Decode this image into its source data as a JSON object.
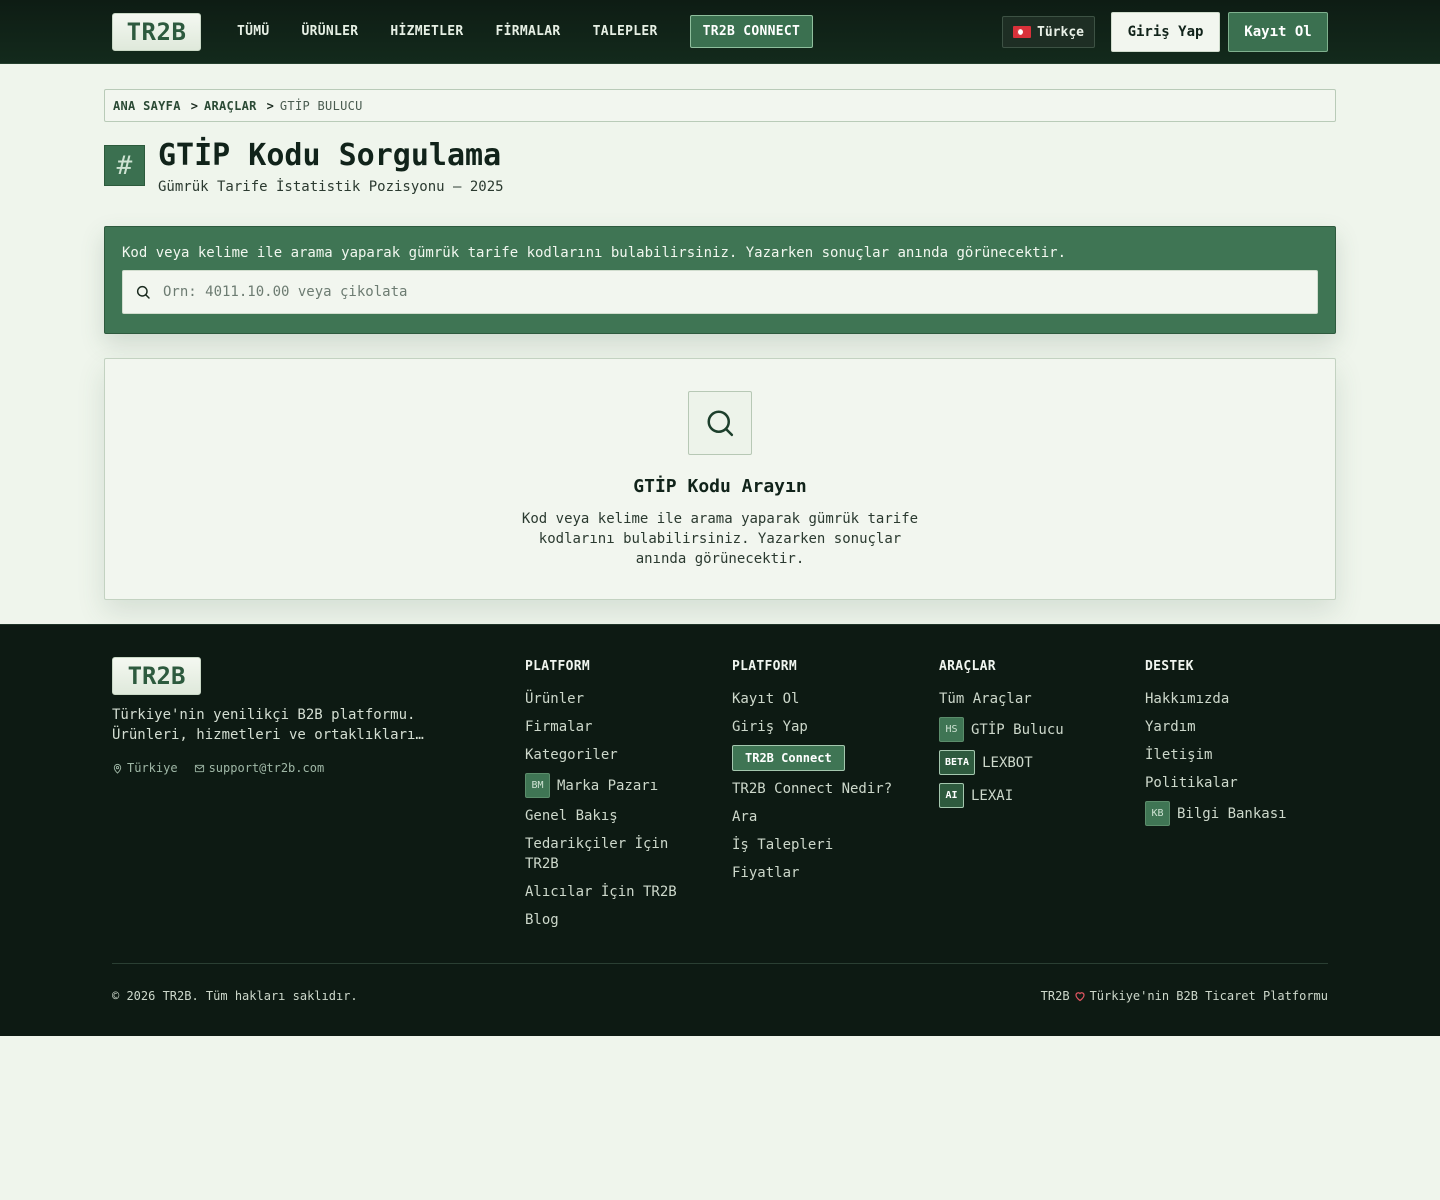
{
  "header": {
    "logo": "TR2B",
    "nav": [
      "TÜMÜ",
      "ÜRÜNLER",
      "HİZMETLER",
      "FİRMALAR",
      "TALEPLER"
    ],
    "connect_label": "TR2B CONNECT",
    "language": "Türkçe",
    "login_label": "Giriş Yap",
    "register_label": "Kayıt Ol"
  },
  "breadcrumb": {
    "home": "ANA SAYFA",
    "tools": "ARAÇLAR",
    "current": "GTİP BULUCU",
    "separator": ">"
  },
  "title": {
    "icon": "#",
    "heading": "GTİP Kodu Sorgulama",
    "subtitle": "Gümrük Tarife İstatistik Pozisyonu — 2025"
  },
  "search": {
    "hint": "Kod veya kelime ile arama yaparak gümrük tarife kodlarını bulabilirsiniz. Yazarken sonuçlar anında görünecektir.",
    "placeholder": "Örn: 4011.10.00 veya çikolata",
    "value": ""
  },
  "empty_state": {
    "title": "GTİP Kodu Arayın",
    "description": "Kod veya kelime ile arama yaparak gümrük tarife kodlarını bulabilirsiniz. Yazarken sonuçlar anında görünecektir."
  },
  "footer": {
    "logo": "TR2B",
    "about_line1": "Türkiye'nin yenilikçi B2B platformu.",
    "about_line2": "Ürünleri, hizmetleri ve ortaklıkları…",
    "location": "Türkiye",
    "email": "support@tr2b.com",
    "col1": {
      "heading": "PLATFORM",
      "links": [
        "Ürünler",
        "Firmalar",
        "Kategoriler",
        "Marka Pazarı",
        "Genel Bakış",
        "Tedarikçiler İçin TR2B",
        "Alıcılar İçin TR2B",
        "Blog"
      ],
      "marka_badge": "BM"
    },
    "col2": {
      "heading": "PLATFORM",
      "links": [
        "Kayıt Ol",
        "Giriş Yap",
        "TR2B Connect",
        "TR2B Connect Nedir?",
        "Ara",
        "İş Talepleri",
        "Fiyatlar"
      ]
    },
    "col3": {
      "heading": "ARAÇLAR",
      "links": [
        "Tüm Araçlar",
        "GTİP Bulucu",
        "LEXBOT",
        "LEXAI"
      ],
      "badges": [
        "HS",
        "BETA",
        "AI"
      ]
    },
    "col4": {
      "heading": "DESTEK",
      "links": [
        "Hakkımızda",
        "Yardım",
        "İletişim",
        "Politikalar",
        "Bilgi Bankası"
      ],
      "kb_badge": "KB"
    },
    "copyright": "© 2026 TR2B. Tüm hakları saklıdır.",
    "tagline_brand": "TR2B",
    "tagline_text": "Türkiye'nin B2B Ticaret Platformu"
  },
  "icons": {
    "search": "search-icon",
    "location": "location-pin-icon",
    "mail": "mail-icon",
    "heart": "heart-icon",
    "flag": "turkey-flag-icon"
  },
  "colors": {
    "brand_green": "#3f7554",
    "header_bg": "#0e1c14",
    "page_bg": "#eff5ec",
    "footer_bg": "#0d1a13"
  }
}
